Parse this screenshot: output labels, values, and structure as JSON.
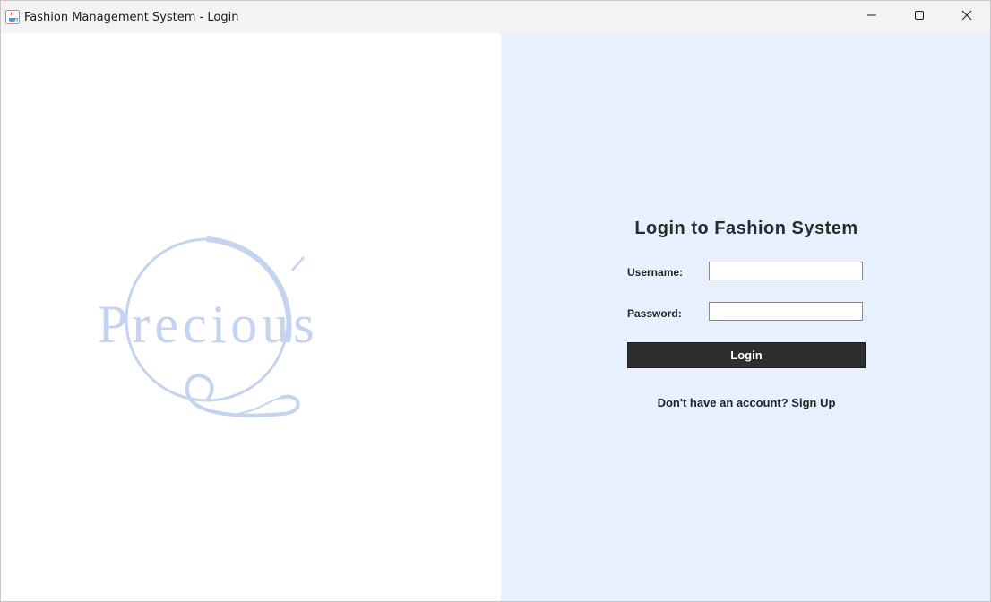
{
  "window": {
    "title": "Fashion Management System - Login",
    "app_icon": "java-coffee-cup-icon",
    "controls": [
      "minimize-icon",
      "maximize-icon",
      "close-icon"
    ]
  },
  "logo": {
    "text": "Precious",
    "color": "#c3d3f0"
  },
  "login": {
    "heading": "Login to Fashion System",
    "username_label": "Username:",
    "username_value": "",
    "password_label": "Password:",
    "password_value": "",
    "login_button": "Login",
    "signup_text": "Don't have an account? Sign Up"
  },
  "colors": {
    "right_panel_bg": "#e8f0fd",
    "button_bg": "#2e2e2e",
    "button_text": "#ffffff"
  }
}
